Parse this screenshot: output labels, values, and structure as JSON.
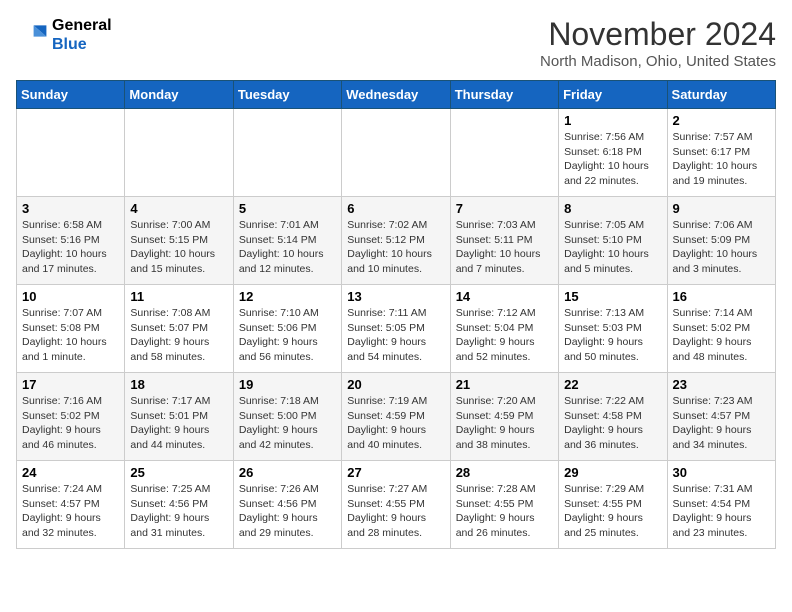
{
  "header": {
    "logo_line1": "General",
    "logo_line2": "Blue",
    "month_title": "November 2024",
    "location": "North Madison, Ohio, United States"
  },
  "weekdays": [
    "Sunday",
    "Monday",
    "Tuesday",
    "Wednesday",
    "Thursday",
    "Friday",
    "Saturday"
  ],
  "weeks": [
    [
      {
        "day": "",
        "info": ""
      },
      {
        "day": "",
        "info": ""
      },
      {
        "day": "",
        "info": ""
      },
      {
        "day": "",
        "info": ""
      },
      {
        "day": "",
        "info": ""
      },
      {
        "day": "1",
        "info": "Sunrise: 7:56 AM\nSunset: 6:18 PM\nDaylight: 10 hours\nand 22 minutes."
      },
      {
        "day": "2",
        "info": "Sunrise: 7:57 AM\nSunset: 6:17 PM\nDaylight: 10 hours\nand 19 minutes."
      }
    ],
    [
      {
        "day": "3",
        "info": "Sunrise: 6:58 AM\nSunset: 5:16 PM\nDaylight: 10 hours\nand 17 minutes."
      },
      {
        "day": "4",
        "info": "Sunrise: 7:00 AM\nSunset: 5:15 PM\nDaylight: 10 hours\nand 15 minutes."
      },
      {
        "day": "5",
        "info": "Sunrise: 7:01 AM\nSunset: 5:14 PM\nDaylight: 10 hours\nand 12 minutes."
      },
      {
        "day": "6",
        "info": "Sunrise: 7:02 AM\nSunset: 5:12 PM\nDaylight: 10 hours\nand 10 minutes."
      },
      {
        "day": "7",
        "info": "Sunrise: 7:03 AM\nSunset: 5:11 PM\nDaylight: 10 hours\nand 7 minutes."
      },
      {
        "day": "8",
        "info": "Sunrise: 7:05 AM\nSunset: 5:10 PM\nDaylight: 10 hours\nand 5 minutes."
      },
      {
        "day": "9",
        "info": "Sunrise: 7:06 AM\nSunset: 5:09 PM\nDaylight: 10 hours\nand 3 minutes."
      }
    ],
    [
      {
        "day": "10",
        "info": "Sunrise: 7:07 AM\nSunset: 5:08 PM\nDaylight: 10 hours\nand 1 minute."
      },
      {
        "day": "11",
        "info": "Sunrise: 7:08 AM\nSunset: 5:07 PM\nDaylight: 9 hours\nand 58 minutes."
      },
      {
        "day": "12",
        "info": "Sunrise: 7:10 AM\nSunset: 5:06 PM\nDaylight: 9 hours\nand 56 minutes."
      },
      {
        "day": "13",
        "info": "Sunrise: 7:11 AM\nSunset: 5:05 PM\nDaylight: 9 hours\nand 54 minutes."
      },
      {
        "day": "14",
        "info": "Sunrise: 7:12 AM\nSunset: 5:04 PM\nDaylight: 9 hours\nand 52 minutes."
      },
      {
        "day": "15",
        "info": "Sunrise: 7:13 AM\nSunset: 5:03 PM\nDaylight: 9 hours\nand 50 minutes."
      },
      {
        "day": "16",
        "info": "Sunrise: 7:14 AM\nSunset: 5:02 PM\nDaylight: 9 hours\nand 48 minutes."
      }
    ],
    [
      {
        "day": "17",
        "info": "Sunrise: 7:16 AM\nSunset: 5:02 PM\nDaylight: 9 hours\nand 46 minutes."
      },
      {
        "day": "18",
        "info": "Sunrise: 7:17 AM\nSunset: 5:01 PM\nDaylight: 9 hours\nand 44 minutes."
      },
      {
        "day": "19",
        "info": "Sunrise: 7:18 AM\nSunset: 5:00 PM\nDaylight: 9 hours\nand 42 minutes."
      },
      {
        "day": "20",
        "info": "Sunrise: 7:19 AM\nSunset: 4:59 PM\nDaylight: 9 hours\nand 40 minutes."
      },
      {
        "day": "21",
        "info": "Sunrise: 7:20 AM\nSunset: 4:59 PM\nDaylight: 9 hours\nand 38 minutes."
      },
      {
        "day": "22",
        "info": "Sunrise: 7:22 AM\nSunset: 4:58 PM\nDaylight: 9 hours\nand 36 minutes."
      },
      {
        "day": "23",
        "info": "Sunrise: 7:23 AM\nSunset: 4:57 PM\nDaylight: 9 hours\nand 34 minutes."
      }
    ],
    [
      {
        "day": "24",
        "info": "Sunrise: 7:24 AM\nSunset: 4:57 PM\nDaylight: 9 hours\nand 32 minutes."
      },
      {
        "day": "25",
        "info": "Sunrise: 7:25 AM\nSunset: 4:56 PM\nDaylight: 9 hours\nand 31 minutes."
      },
      {
        "day": "26",
        "info": "Sunrise: 7:26 AM\nSunset: 4:56 PM\nDaylight: 9 hours\nand 29 minutes."
      },
      {
        "day": "27",
        "info": "Sunrise: 7:27 AM\nSunset: 4:55 PM\nDaylight: 9 hours\nand 28 minutes."
      },
      {
        "day": "28",
        "info": "Sunrise: 7:28 AM\nSunset: 4:55 PM\nDaylight: 9 hours\nand 26 minutes."
      },
      {
        "day": "29",
        "info": "Sunrise: 7:29 AM\nSunset: 4:55 PM\nDaylight: 9 hours\nand 25 minutes."
      },
      {
        "day": "30",
        "info": "Sunrise: 7:31 AM\nSunset: 4:54 PM\nDaylight: 9 hours\nand 23 minutes."
      }
    ]
  ]
}
